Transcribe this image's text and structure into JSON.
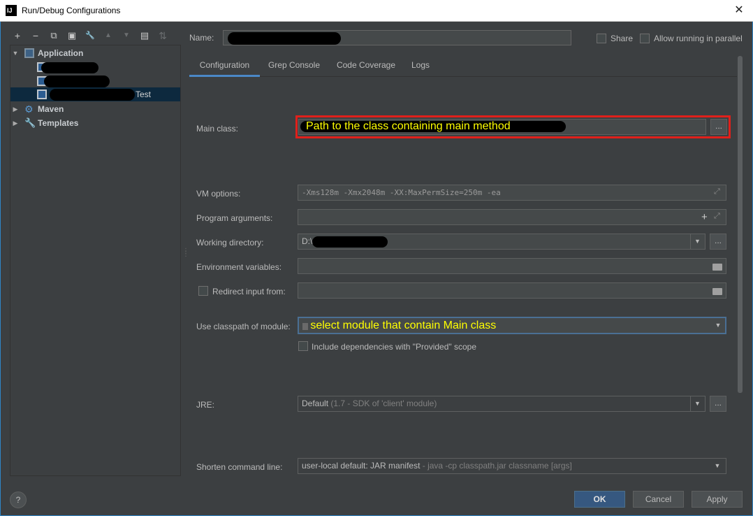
{
  "window": {
    "title": "Run/Debug Configurations",
    "logo": "IJ",
    "close": "✕"
  },
  "toolbar": {
    "items": [
      {
        "name": "add-icon",
        "glyph": "+"
      },
      {
        "name": "remove-icon",
        "glyph": "−"
      },
      {
        "name": "copy-icon",
        "glyph": "⧉"
      },
      {
        "name": "save-icon",
        "glyph": "▣"
      },
      {
        "name": "wrench-icon",
        "glyph": "🔧"
      },
      {
        "name": "move-up-icon",
        "glyph": "▲"
      },
      {
        "name": "move-down-icon",
        "glyph": "▼"
      },
      {
        "name": "folder-icon",
        "glyph": "▤"
      },
      {
        "name": "sort-icon",
        "glyph": "⇅"
      }
    ]
  },
  "tree": {
    "application": "Application",
    "config3_suffix": "Test",
    "maven": "Maven",
    "templates": "Templates"
  },
  "form": {
    "name_label": "Name:",
    "share_label": "Share",
    "allow_parallel_label": "Allow running in parallel",
    "tabs": [
      "Configuration",
      "Grep Console",
      "Code Coverage",
      "Logs"
    ],
    "main_class_label": "Main class:",
    "main_class_annotation": "Path to the class containing main method",
    "dots": "...",
    "vm_options_label": "VM options:",
    "vm_options_value": "-Xms128m -Xmx2048m -XX:MaxPermSize=250m -ea",
    "program_args_label": "Program arguments:",
    "program_args_plus": "+",
    "working_dir_label": "Working directory:",
    "working_dir_value": "D:\\",
    "env_vars_label": "Environment variables:",
    "redirect_label": "Redirect input from:",
    "classpath_label": "Use classpath of module:",
    "classpath_annotation": "select module that contain Main class",
    "include_deps_label": "Include dependencies with \"Provided\" scope",
    "jre_label": "JRE:",
    "jre_value": "Default",
    "jre_detail": "(1.7 - SDK of 'client' module)",
    "shorten_label": "Shorten command line:",
    "shorten_value": "user-local default: JAR manifest",
    "shorten_detail": "- java -cp classpath.jar classname [args]"
  },
  "buttons": {
    "help": "?",
    "ok": "OK",
    "cancel": "Cancel",
    "apply": "Apply"
  },
  "colors": {
    "background": "#3c3f41",
    "selection": "#0d293e",
    "primary": "#365880",
    "annotation": "#ffff00",
    "highlight_border": "#e0201b"
  }
}
